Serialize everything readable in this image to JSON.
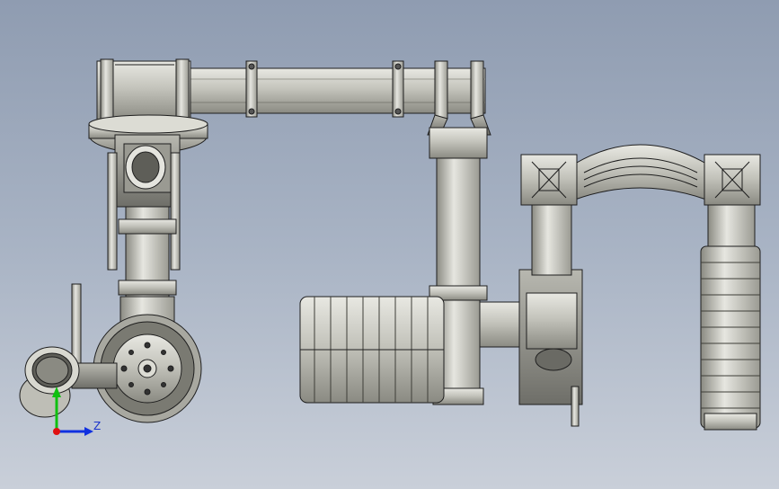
{
  "view": {
    "background_top": "#8f9cb1",
    "background_bottom": "#c9cfd9",
    "metal_color": "#c8c8c0",
    "edge_color": "#1e1e1e"
  },
  "triad": {
    "z_label": "Z",
    "x_color": "#e01010",
    "y_color": "#10c010",
    "z_color": "#1030e0"
  }
}
